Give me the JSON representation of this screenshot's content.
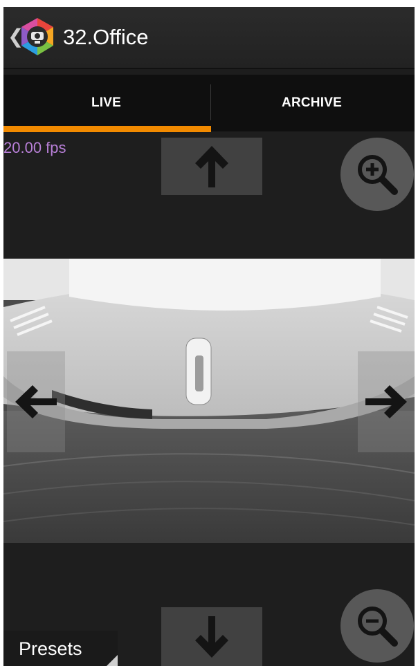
{
  "header": {
    "title": "32.Office",
    "back_glyph": "❮",
    "logo_icon": "camera-hexagon-logo-icon"
  },
  "tabs": [
    {
      "label": "LIVE",
      "selected": true
    },
    {
      "label": "ARCHIVE",
      "selected": false
    }
  ],
  "stream": {
    "fps_text": "20.00 fps"
  },
  "controls": {
    "up_icon": "arrow-up-icon",
    "down_icon": "arrow-down-icon",
    "left_icon": "arrow-left-icon",
    "right_icon": "arrow-right-icon",
    "zoom_in_icon": "zoom-in-icon",
    "zoom_out_icon": "zoom-out-icon",
    "presets_label": "Presets"
  },
  "colors": {
    "accent": "#f28a00",
    "fps_text": "#b77fd6",
    "background": "#1d1d1d"
  }
}
